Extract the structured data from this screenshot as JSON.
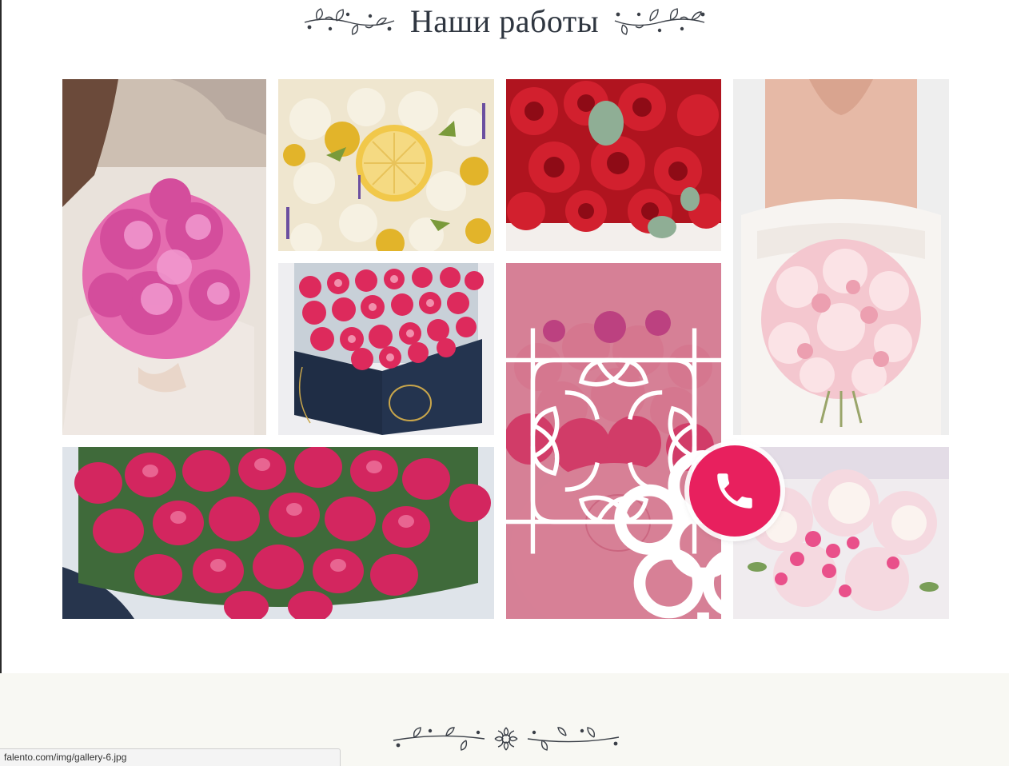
{
  "section": {
    "title": "Наши работы"
  },
  "gallery": {
    "items": [
      {
        "name": "gallery-item-pink-peony-bouquet",
        "subject": "pink peony bridal bouquet"
      },
      {
        "name": "gallery-item-lemon-rose-arrangement",
        "subject": "lemons with white roses"
      },
      {
        "name": "gallery-item-red-rose-arrangement",
        "subject": "red roses with eucalyptus"
      },
      {
        "name": "gallery-item-bride-pink-bouquet",
        "subject": "bride with pale pink bouquet"
      },
      {
        "name": "gallery-item-rose-hatbox",
        "subject": "pink roses in dark blue box"
      },
      {
        "name": "gallery-item-flower-box-hovered",
        "subject": "flower box (hover overlay)"
      },
      {
        "name": "gallery-item-pink-tulips",
        "subject": "pink tulips"
      },
      {
        "name": "gallery-item-pink-hydrangea-arrangement",
        "subject": "pink hydrangea centerpiece"
      }
    ]
  },
  "icons": {
    "hover_icon": "flower-outline-icon",
    "call_icon": "phone-icon",
    "ornament": "floral-divider-ornament"
  },
  "colors": {
    "accent": "#e8205e",
    "overlay": "#c43c5f",
    "title": "#2f3640",
    "footer_band": "#f8f8f3"
  },
  "status_bar": {
    "url": "falento.com/img/gallery-6.jpg"
  }
}
